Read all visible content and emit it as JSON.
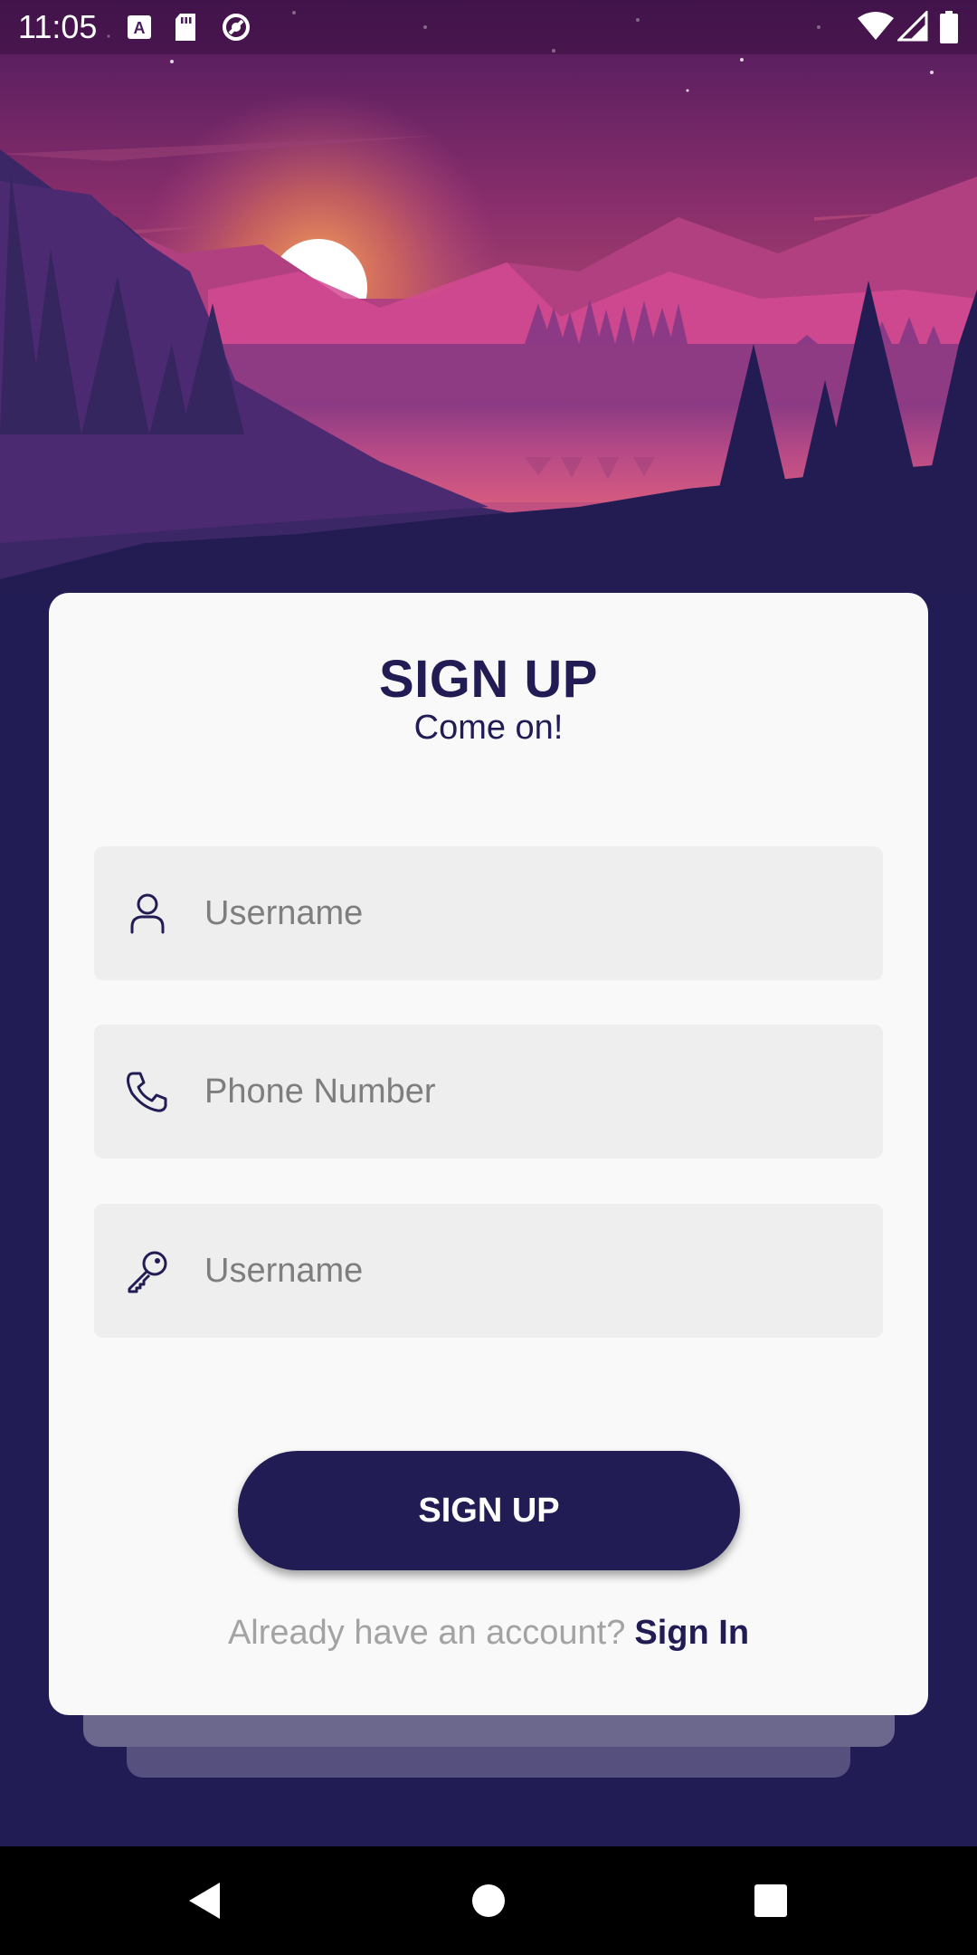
{
  "status_bar": {
    "time": "11:05",
    "left_icons": [
      "keyboard-icon",
      "sd-card-icon",
      "data-saver-icon"
    ],
    "right_icons": [
      "wifi-icon",
      "signal-icon",
      "battery-icon"
    ]
  },
  "landscape": {
    "sky_top": "#5a1e63",
    "sky_mid": "#a5406f",
    "sun_glow": "#f0884e",
    "mountain_pink": "#c8478f",
    "forest_dark": "#231c52"
  },
  "card": {
    "title": "SIGN UP",
    "subtitle": "Come on!"
  },
  "form": {
    "username": {
      "placeholder": "Username",
      "value": "",
      "icon": "user-icon"
    },
    "phone": {
      "placeholder": "Phone Number",
      "value": "",
      "icon": "phone-icon"
    },
    "password": {
      "placeholder": "Username",
      "value": "",
      "icon": "key-icon"
    }
  },
  "signup_button": {
    "label": "SIGN UP"
  },
  "signin": {
    "prompt": "Already have an account?",
    "link": "Sign In"
  },
  "colors": {
    "primary": "#221c55",
    "card_bg": "#f9f9f9",
    "field_bg": "#eeeeee",
    "placeholder": "#7e7e7e",
    "muted_text": "#a3a3a3"
  },
  "nav_bar": {
    "buttons": [
      "back-icon",
      "home-icon",
      "recents-icon"
    ]
  }
}
